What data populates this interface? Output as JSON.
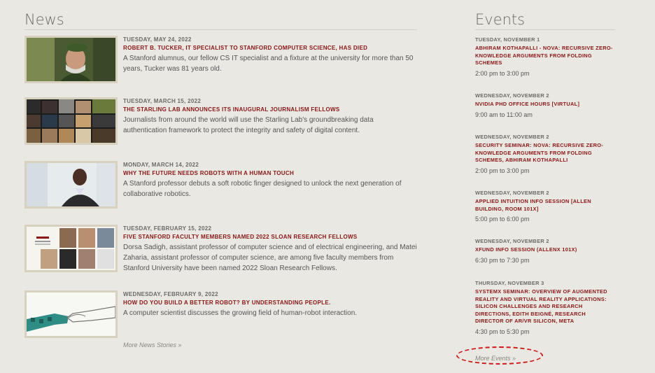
{
  "news": {
    "title": "News",
    "items": [
      {
        "date": "TUESDAY, MAY 24, 2022",
        "headline": "ROBERT B. TUCKER, IT SPECIALIST TO STANFORD COMPUTER SCIENCE, HAS DIED",
        "summary": "A Stanford alumnus, our fellow CS IT specialist and a fixture at the university for more than 50 years, Tucker was 81 years old."
      },
      {
        "date": "TUESDAY, MARCH 15, 2022",
        "headline": "THE STARLING LAB ANNOUNCES ITS INAUGURAL JOURNALISM FELLOWS",
        "summary": "Journalists from around the world will use the Starling Lab's groundbreaking data authentication framework to protect the integrity and safety of digital content."
      },
      {
        "date": "MONDAY, MARCH 14, 2022",
        "headline": "WHY THE FUTURE NEEDS ROBOTS WITH A HUMAN TOUCH",
        "summary": "A Stanford professor debuts a soft robotic finger designed to unlock the next generation of collaborative robotics."
      },
      {
        "date": "TUESDAY, FEBRUARY 15, 2022",
        "headline": "FIVE STANFORD FACULTY MEMBERS NAMED 2022 SLOAN RESEARCH FELLOWS",
        "summary": "Dorsa Sadigh, assistant professor of computer science and of electrical engineering, and Matei Zaharia, assistant professor of computer science, are among five faculty members from Stanford University have been named 2022 Sloan Research Fellows."
      },
      {
        "date": "WEDNESDAY, FEBRUARY 9, 2022",
        "headline": "HOW DO YOU BUILD A BETTER ROBOT? BY UNDERSTANDING PEOPLE.",
        "summary": "A computer scientist discusses the growing field of human-robot interaction."
      }
    ],
    "more_label": "More News Stories »"
  },
  "events": {
    "title": "Events",
    "items": [
      {
        "date": "TUESDAY, NOVEMBER 1",
        "title": "ABHIRAM KOTHAPALLI - NOVA: RECURSIVE ZERO-KNOWLEDGE ARGUMENTS FROM FOLDING SCHEMES",
        "time": "2:00 pm to 3:00 pm"
      },
      {
        "date": "WEDNESDAY, NOVEMBER 2",
        "title": "NVIDIA PHD OFFICE HOURS [VIRTUAL]",
        "time": "9:00 am to 11:00 am"
      },
      {
        "date": "WEDNESDAY, NOVEMBER 2",
        "title": "SECURITY SEMINAR: NOVA: RECURSIVE ZERO-KNOWLEDGE ARGUMENTS FROM FOLDING SCHEMES, ABHIRAM KOTHAPALLI",
        "time": "2:00 pm to 3:00 pm"
      },
      {
        "date": "WEDNESDAY, NOVEMBER 2",
        "title": "APPLIED INTUITION INFO SESSION [ALLEN BUILDING, ROOM 101X]",
        "time": "5:00 pm to 6:00 pm"
      },
      {
        "date": "WEDNESDAY, NOVEMBER 2",
        "title": "XFUND INFO SESSION (ALLENX 101X)",
        "time": "6:30 pm to 7:30 pm"
      },
      {
        "date": "THURSDAY, NOVEMBER 3",
        "title": "SYSTEMX SEMINAR: OVERVIEW OF AUGMENTED REALITY AND VIRTUAL REALITY APPLICATIONS: SILICON CHALLENGES AND RESEARCH DIRECTIONS, EDITH BEIGNÉ, RESEARCH DIRECTOR OF AR/VR SILICON, META",
        "time": "4:30 pm to 5:30 pm"
      }
    ],
    "more_label": "More Events »"
  },
  "colors": {
    "accent": "#8c1515",
    "background": "#eae8e3",
    "highlight": "#d01818"
  }
}
